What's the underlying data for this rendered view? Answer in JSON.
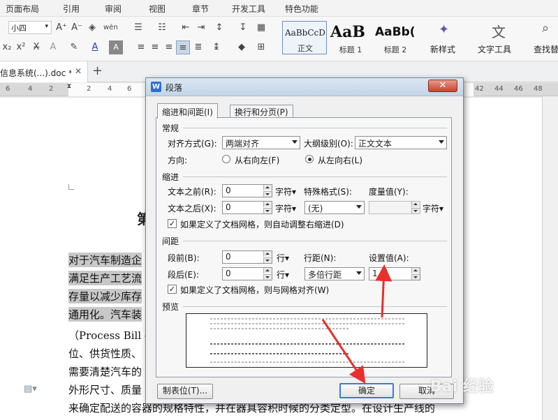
{
  "menu": {
    "items": [
      "页面布局",
      "引用",
      "审阅",
      "视图",
      "章节",
      "开发工具",
      "特色功能"
    ]
  },
  "ribbon": {
    "font_size": "小四",
    "styles": [
      {
        "preview": "AaBbCcD",
        "name": "正文"
      },
      {
        "preview": "AaB",
        "name": "标题 1"
      },
      {
        "preview": "AaBb(",
        "name": "标题 2"
      }
    ],
    "new_style": "新样式",
    "text_tools": "文字工具",
    "find_replace": "查找替"
  },
  "tabs": {
    "doc_title": "信息系统(...).doc *",
    "close": "✕",
    "add": "+"
  },
  "ruler": {
    "left_nums": [
      "6",
      "4",
      "2",
      "2",
      "4",
      "6"
    ],
    "right_nums": [
      "42",
      "44",
      "46",
      "48"
    ]
  },
  "document": {
    "heading_fragment": "第",
    "lines": [
      "对于汽车制造企",
      "满足生产工艺流",
      "存量以减少库存",
      "通用化。汽车装",
      "（Process Bill of",
      "位、供货性质、",
      "需要清楚汽车的",
      "外形尺寸、质量",
      "来确定配送的容器的规格特性，并在器具容积时候的分类定型。在设计生产线的"
    ]
  },
  "dialog": {
    "title": "段落",
    "tabs": [
      "缩进和间距(I)",
      "换行和分页(P)"
    ],
    "general": {
      "section": "常规",
      "align_label": "对齐方式(G):",
      "align_value": "两端对齐",
      "outline_label": "大纲级别(O):",
      "outline_value": "正文文本",
      "direction_label": "方向:",
      "rtl_label": "从右向左(F)",
      "ltr_label": "从左向右(L)",
      "direction_selected": "ltr"
    },
    "indent": {
      "section": "缩进",
      "before_label": "文本之前(R):",
      "before_value": "0",
      "before_unit": "字符▾",
      "after_label": "文本之后(X):",
      "after_value": "0",
      "after_unit": "字符▾",
      "special_label": "特殊格式(S):",
      "special_value": "(无)",
      "measure_label": "度量值(Y):",
      "measure_value": "",
      "measure_unit": "字符▾",
      "grid_check_label": "如果定义了文档网格，则自动调整右缩进(D)",
      "grid_checked": true
    },
    "spacing": {
      "section": "间距",
      "before_label": "段前(B):",
      "before_value": "0",
      "before_unit": "行▾",
      "after_label": "段后(E):",
      "after_value": "0",
      "after_unit": "行▾",
      "line_label": "行距(N):",
      "line_value": "多倍行距",
      "set_label": "设置值(A):",
      "set_value": "1.5",
      "grid_check_label": "如果定义了文档网格，则与网格对齐(W)",
      "grid_checked": true
    },
    "preview_label": "预览",
    "buttons": {
      "tabs": "制表位(T)...",
      "ok": "确定",
      "cancel": "取消"
    }
  },
  "watermark": "Bai 经验",
  "colors": {
    "accent": "#e8302c",
    "highlight": "#c8c8c8"
  }
}
